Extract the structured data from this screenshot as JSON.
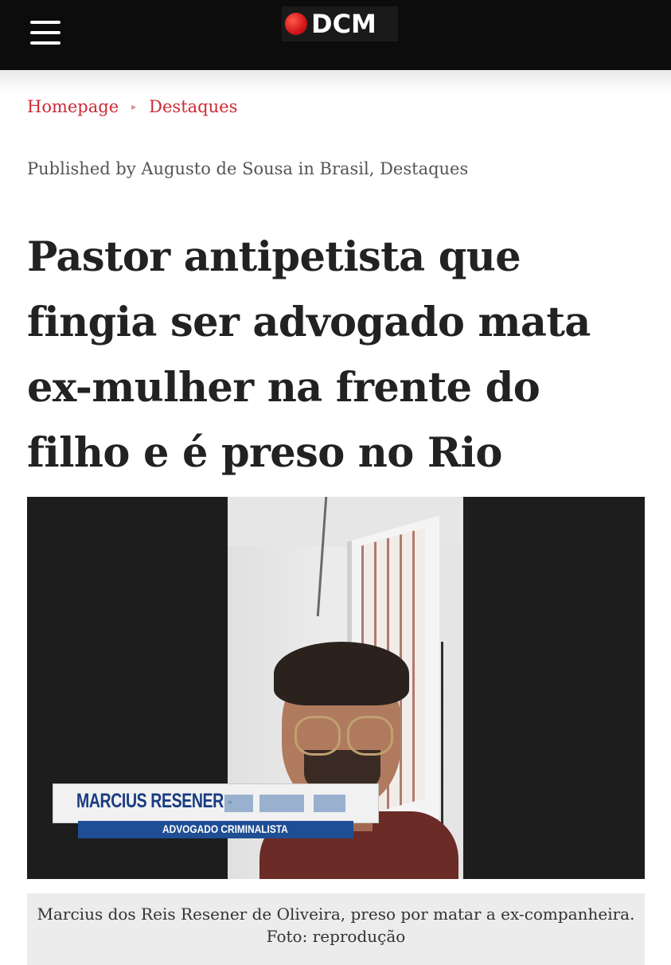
{
  "header": {
    "menu_icon": "hamburger-menu-icon",
    "logo_text": "DCM",
    "logo_colors": {
      "dot": "#d4141a",
      "background": "#0c0c0c"
    }
  },
  "breadcrumb": {
    "items": [
      "Homepage",
      "Destaques"
    ],
    "separator": "▸"
  },
  "byline": "Published by Augusto de Sousa in Brasil, Destaques",
  "headline": "Pastor antipetista que fingia ser advogado mata ex-mulher na frente do filho e é preso no Rio",
  "image": {
    "lower_third_name": "MARCIUS RESENER -",
    "lower_third_role": "ADVOGADO CRIMINALISTA"
  },
  "caption": "Marcius dos Reis Resener de Oliveira, preso por matar a ex-companheira. Foto: reprodução",
  "colors": {
    "accent": "#cc2a36",
    "headline": "#222222",
    "byline": "#555555"
  }
}
